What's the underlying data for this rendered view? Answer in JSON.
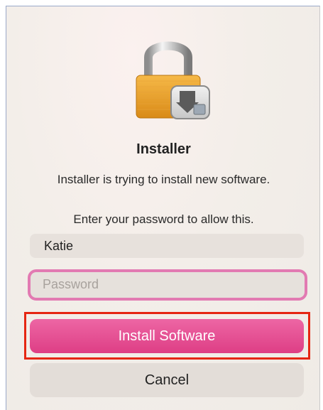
{
  "dialog": {
    "title": "Installer",
    "message": "Installer is trying to install new software.",
    "prompt": "Enter your password to allow this.",
    "username_value": "Katie",
    "password_placeholder": "Password",
    "install_label": "Install Software",
    "cancel_label": "Cancel"
  },
  "colors": {
    "accent": "#e24f93",
    "highlight_box": "#e52612",
    "focus_ring": "#e27ab2"
  },
  "icons": {
    "app_icon": "lock-icon",
    "badge": "installer-package-icon"
  }
}
